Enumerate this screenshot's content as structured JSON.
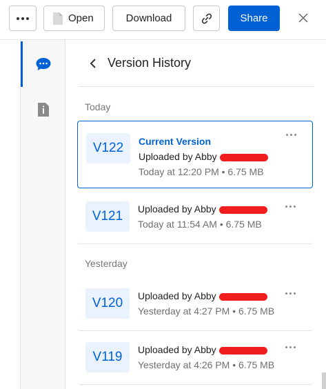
{
  "toolbar": {
    "open_label": "Open",
    "download_label": "Download",
    "share_label": "Share",
    "icons": {
      "more": "more-dots-icon",
      "file": "file-icon",
      "link": "link-icon",
      "close": "close-icon"
    }
  },
  "rail": {
    "icons": [
      "comment-icon",
      "info-icon"
    ]
  },
  "panel": {
    "title": "Version History"
  },
  "sections": [
    {
      "label": "Today",
      "versions": [
        {
          "badge": "V122",
          "current_label": "Current Version",
          "uploader": "Uploaded by Abby",
          "meta": "Today at 12:20 PM • 6.75 MB"
        },
        {
          "badge": "V121",
          "uploader": "Uploaded by Abby",
          "meta": "Today at 11:54 AM • 6.75 MB"
        }
      ]
    },
    {
      "label": "Yesterday",
      "versions": [
        {
          "badge": "V120",
          "uploader": "Uploaded by Abby",
          "meta": "Yesterday at 4:27 PM • 6.75 MB"
        },
        {
          "badge": "V119",
          "uploader": "Uploaded by Abby",
          "meta": "Yesterday at 4:26 PM • 6.75 MB"
        }
      ]
    }
  ],
  "colors": {
    "accent": "#0061d5",
    "badge_bg": "#e9f2fd",
    "redaction": "#f21d1d"
  }
}
